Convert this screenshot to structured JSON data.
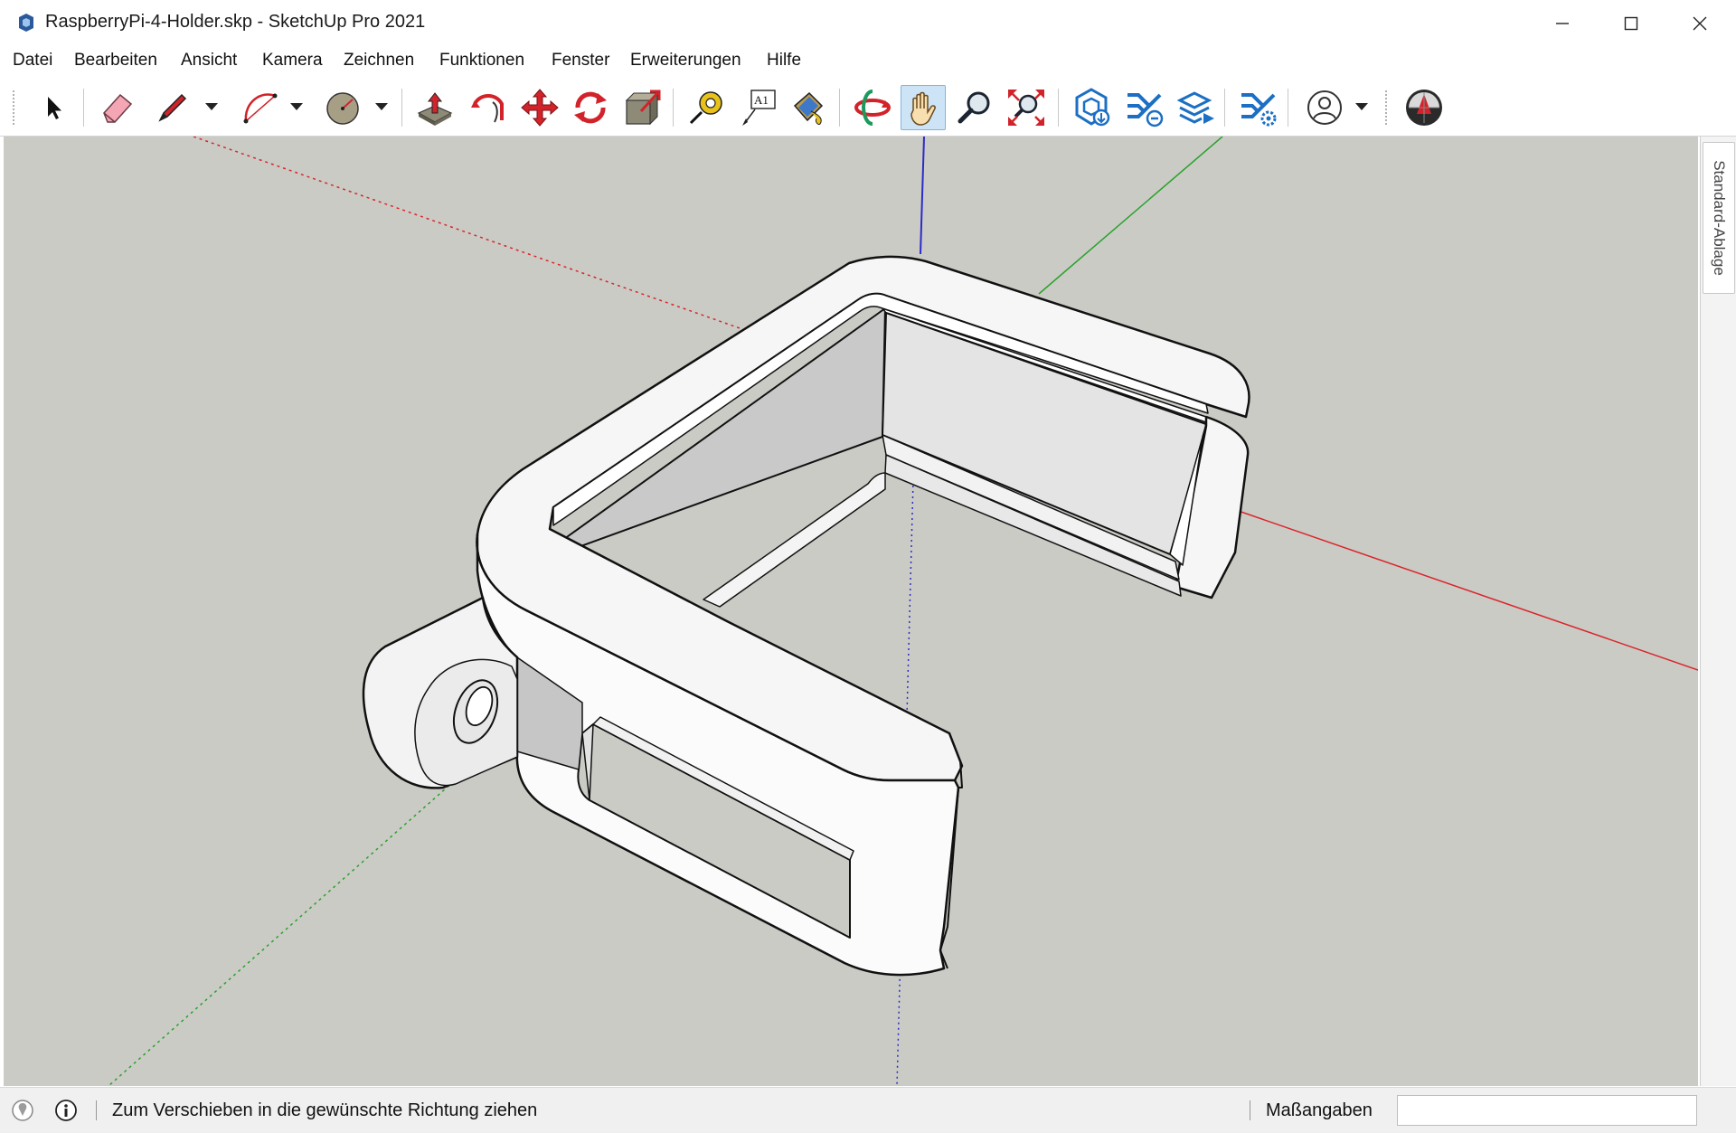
{
  "window": {
    "title": "RaspberryPi-4-Holder.skp - SketchUp Pro 2021",
    "app_icon": "sketchup-icon",
    "controls": [
      "minimize-icon",
      "maximize-icon",
      "close-icon"
    ]
  },
  "menu": {
    "items": [
      {
        "label": "Datei",
        "key": "D",
        "rest": "atei"
      },
      {
        "label": "Bearbeiten",
        "key": "B",
        "rest": "earbeiten"
      },
      {
        "label": "Ansicht",
        "key": "A",
        "rest": "nsicht"
      },
      {
        "label": "Kamera",
        "key": "K",
        "rest": "amera"
      },
      {
        "label": "Zeichnen",
        "key": "Ze",
        "keyidx": 1,
        "pre": "Ze",
        "ul": "i",
        "post": "chnen"
      },
      {
        "label": "Funktionen",
        "key": "F",
        "rest": "unktionen"
      },
      {
        "label": "Fenster",
        "key": "F",
        "rest": "enster"
      },
      {
        "label": "Erweiterungen",
        "pre": "E",
        "ul": "r",
        "post": "weiterungen"
      },
      {
        "label": "Hilfe",
        "key": "H",
        "rest": "ilfe"
      }
    ]
  },
  "toolbar": {
    "tools": [
      "select-arrow-icon",
      "eraser-icon",
      "pencil-line-icon",
      "arc-icon",
      "circle-icon",
      "push-pull-icon",
      "follow-me-icon",
      "move-icon",
      "rotate-icon",
      "scale-icon",
      "tape-measure-icon",
      "text-icon",
      "paint-bucket-icon",
      "orbit-icon",
      "pan-hand-icon",
      "zoom-icon",
      "zoom-extents-icon",
      "3d-warehouse-icon",
      "extension-warehouse-icon",
      "layout-send-icon",
      "extension-manager-icon",
      "account-icon",
      "trimble-connect-icon"
    ],
    "active_tool": "pan-hand-icon",
    "text_tool_label": "A1"
  },
  "viewport": {
    "background": "#cbcbc6",
    "axes": {
      "red": "#d9262b",
      "green": "#2aa12c",
      "blue": "#2b2bc9"
    },
    "model_fill": "#f2f2f2"
  },
  "side_panel": {
    "tab_label": "Standard-Ablage"
  },
  "status": {
    "message": "Zum Verschieben in die gewünschte Richtung ziehen",
    "measurements_label": "Maßangaben",
    "measurements_value": ""
  }
}
